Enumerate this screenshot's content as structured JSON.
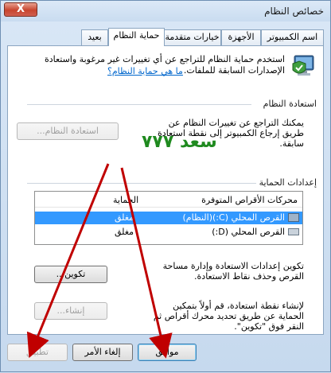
{
  "window": {
    "title": "خصائص النظام",
    "close_label": "X"
  },
  "tabs": [
    {
      "label": "اسم الكمبيوتر"
    },
    {
      "label": "الأجهزة"
    },
    {
      "label": "خيارات متقدمة"
    },
    {
      "label": "حماية النظام"
    },
    {
      "label": "بعيد"
    }
  ],
  "intro": {
    "text": "استخدم حماية النظام للتراجع عن أي تغييرات غير مرغوبة واستعادة الإصدارات السابقة للملفات.",
    "link": "ما هي حماية النظام؟"
  },
  "restore": {
    "title": "استعادة النظام",
    "text": "يمكنك التراجع عن تغييرات النظام عن طريق إرجاع الكمبيوتر إلى نقطة استعادة سابقة.",
    "button": "استعادة النظام...",
    "watermark": "سعد ٧٧٧"
  },
  "protection": {
    "title": "إعدادات الحماية",
    "columns": [
      "محركات الأقراص المتوفرة",
      "الحماية"
    ],
    "rows": [
      {
        "drive": "القرص المحلي (C:)(النظام)",
        "status": "مغلق"
      },
      {
        "drive": "القرص المحلي (D:)",
        "status": "مغلق"
      }
    ],
    "configure_text": "تكوين إعدادات الاستعادة وإدارة مساحة القرص وحذف نقاط الاستعادة.",
    "configure_button": "تكوين...",
    "create_text": "لإنشاء نقطة استعادة، قم أولاً بتمكين الحماية عن طريق تحديد محرك أقراص ثم النقر فوق \"تكوين\".",
    "create_button": "إنشاء..."
  },
  "footer": {
    "ok": "موافق",
    "cancel": "إلغاء الأمر",
    "apply": "تطبيق"
  },
  "colors": {
    "annotation_arrows": "#c00000",
    "watermark": "#1f8a1f"
  }
}
